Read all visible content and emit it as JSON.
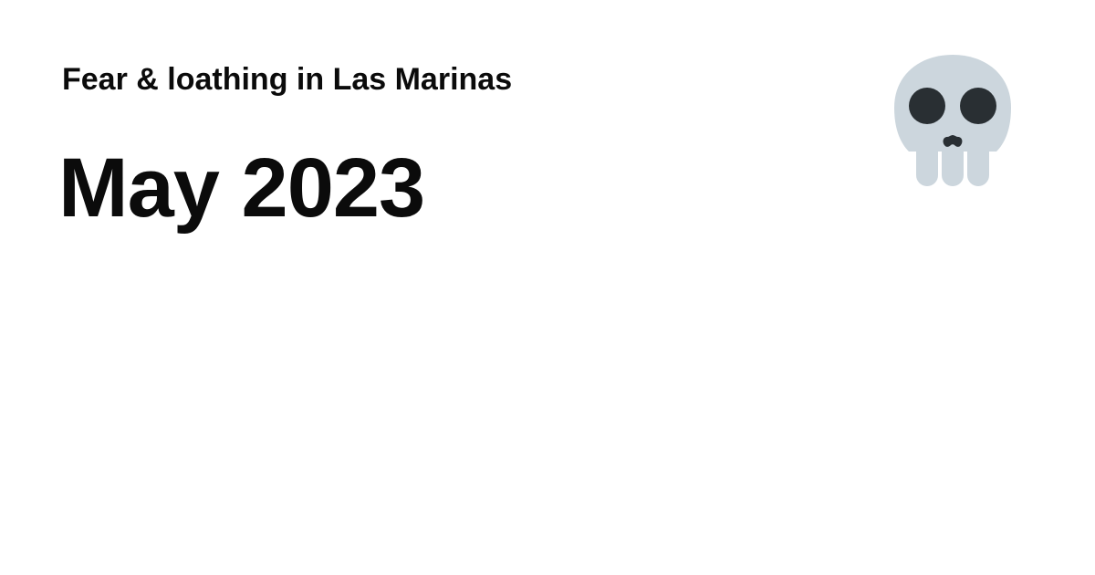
{
  "site": {
    "title": "Fear & loathing in Las Marinas",
    "logo_icon": "skull-icon"
  },
  "page": {
    "title": "May 2023"
  },
  "colors": {
    "background": "#ffffff",
    "text": "#0b0b0b",
    "skull_bone": "#ccd6dd",
    "skull_eyes": "#292f33"
  }
}
